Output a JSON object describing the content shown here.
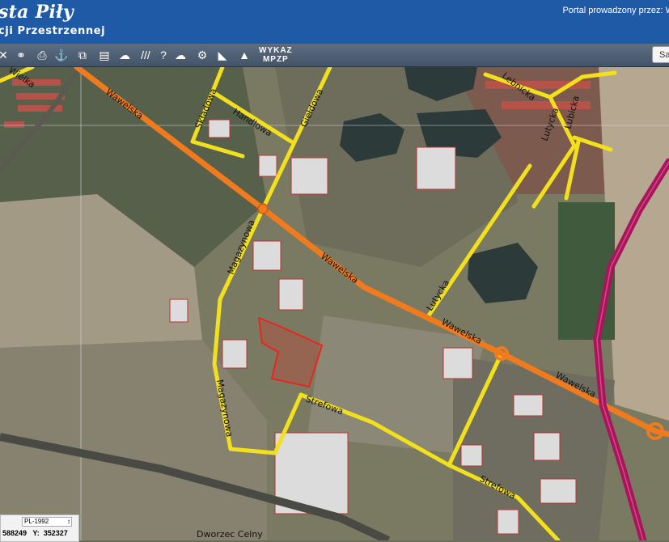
{
  "header": {
    "title": "sta Piły",
    "subtitle": "cji Przestrzennej",
    "portal_text": "Portal prowadzony przez: W"
  },
  "toolbar": {
    "wykaz_line1": "WYKAZ",
    "wykaz_line2": "MPZP",
    "search_label": "Sa",
    "tools": [
      "measure-icon",
      "link-icon",
      "print-icon",
      "info-icon",
      "export-icon",
      "layout-icon",
      "shape-icon",
      "hatch-icon",
      "help-icon",
      "cloud-icon",
      "settings-icon",
      "layers-icon"
    ]
  },
  "map": {
    "streets": {
      "wawelska_1": "Wawelska",
      "wawelska_2": "Wawelska",
      "wawelska_3": "Wawelska",
      "wawelska_4": "Wawelska",
      "skladowa": "Składowa",
      "handlowa": "Handlowa",
      "gieldowa": "Giełdowa",
      "magazynowa_1": "Magazynowa",
      "magazynowa_2": "Magazynowa",
      "strefowa_1": "Strefowa",
      "strefowa_2": "Strefowa",
      "lutycka_1": "Lutycka",
      "lutycka_2": "Lutycka",
      "lebnicka": "Lebnicka",
      "lubicka": "Lubicka",
      "street_nw": "Wielka",
      "dworzec": "Dworzec Celny"
    },
    "colors": {
      "main_road": "#f07a1e",
      "local_road": "#f3e01c",
      "expressway": "#a8155a",
      "parcel": "#e8261e"
    }
  },
  "coords": {
    "crs": "PL-1992",
    "x_label": "X:",
    "x_value": "588249",
    "y_label": "Y:",
    "y_value": "352327"
  }
}
